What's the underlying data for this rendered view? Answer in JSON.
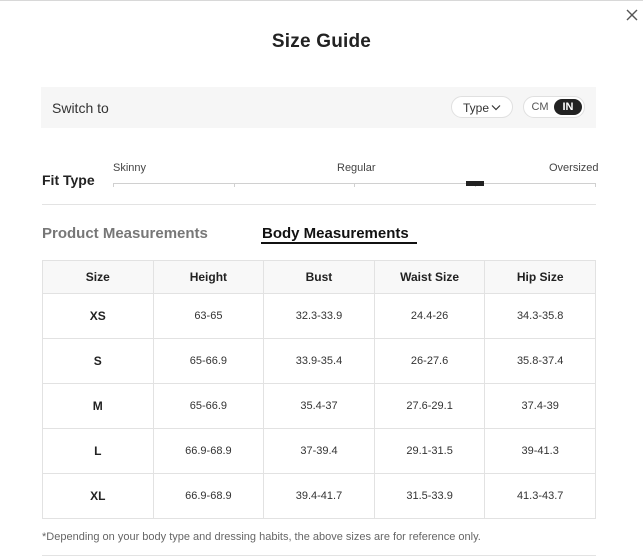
{
  "dialog": {
    "title": "Size Guide"
  },
  "switch_bar": {
    "label": "Switch to",
    "type_dropdown": "Type",
    "units": {
      "cm": "CM",
      "in": "IN",
      "selected": "IN"
    }
  },
  "fit_type": {
    "label": "Fit Type",
    "options": [
      "Skinny",
      "Regular",
      "Oversized"
    ],
    "marker_level": 0.75
  },
  "tabs": [
    {
      "label": "Product Measurements",
      "active": false
    },
    {
      "label": "Body Measurements",
      "active": true
    }
  ],
  "table": {
    "headers": [
      "Size",
      "Height",
      "Bust",
      "Waist Size",
      "Hip Size"
    ],
    "rows": [
      [
        "XS",
        "63-65",
        "32.3-33.9",
        "24.4-26",
        "34.3-35.8"
      ],
      [
        "S",
        "65-66.9",
        "33.9-35.4",
        "26-27.6",
        "35.8-37.4"
      ],
      [
        "M",
        "65-66.9",
        "35.4-37",
        "27.6-29.1",
        "37.4-39"
      ],
      [
        "L",
        "66.9-68.9",
        "37-39.4",
        "29.1-31.5",
        "39-41.3"
      ],
      [
        "XL",
        "66.9-68.9",
        "39.4-41.7",
        "31.5-33.9",
        "41.3-43.7"
      ]
    ]
  },
  "footnote": "*Depending on your body type and dressing habits, the above sizes are for reference only."
}
